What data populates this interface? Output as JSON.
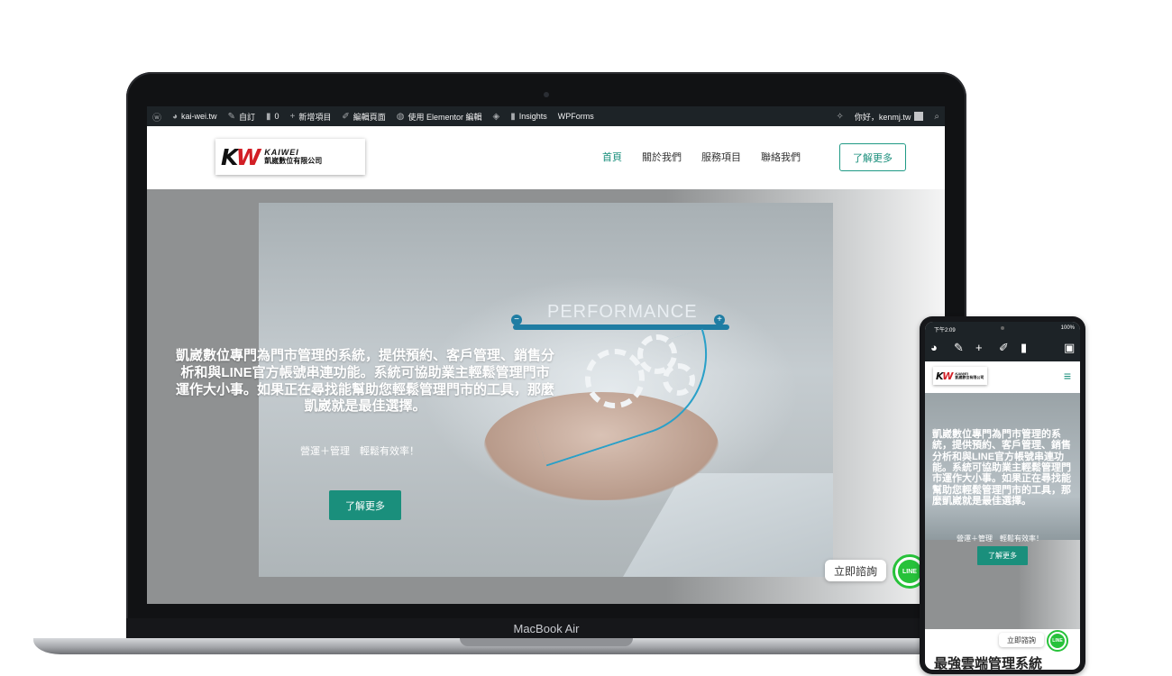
{
  "laptop": {
    "model_label": "MacBook Air",
    "admin_bar": {
      "wp_icon": "wordpress-icon",
      "site": "kai-wei.tw",
      "customize": "自訂",
      "comments_count": "0",
      "new_item": "新增項目",
      "edit_page": "編輯頁面",
      "elementor_edit": "使用 Elementor 編輯",
      "insights": "Insights",
      "wpforms": "WPForms",
      "greeting": "你好，kenmj.tw"
    },
    "header": {
      "logo_en": "KAIWEI",
      "logo_zh": "凱崴數位有限公司",
      "logo_mark_k": "K",
      "logo_mark_w": "W",
      "nav": [
        "首頁",
        "關於我們",
        "服務項目",
        "聯絡我們"
      ],
      "cta": "了解更多"
    },
    "hero": {
      "photo_text": "PERFORMANCE",
      "headline": "凱崴數位專門為門市管理的系統，提供預約、客戶管理、銷售分析和與LINE官方帳號串連功能。系統可協助業主輕鬆管理門市運作大小事。如果正在尋找能幫助您輕鬆管理門市的工具，那麼凱崴就是最佳選擇。",
      "subline": "營運＋管理　輕鬆有效率！",
      "button": "了解更多"
    },
    "floating": {
      "consult_label": "立即諮詢",
      "line_label": "LINE"
    }
  },
  "phone": {
    "status": {
      "time": "下午2:09",
      "battery": "100%"
    },
    "header": {
      "logo_en": "KAIWEI",
      "logo_zh": "凱崴數位有限公司"
    },
    "hero": {
      "headline": "凱崴數位專門為門市管理的系統，提供預約、客戶管理、銷售分析和與LINE官方帳號串連功能。系統可協助業主輕鬆管理門市運作大小事。如果正在尋找能幫助您輕鬆管理門市的工具，那麼凱崴就是最佳選擇。",
      "subline": "營運＋管理　輕鬆有效率！",
      "button": "了解更多"
    },
    "floating": {
      "consult_label": "立即諮詢",
      "line_label": "LINE"
    },
    "bottom_title": "最強雲端管理系統"
  },
  "colors": {
    "brand_green": "#1a8f7c",
    "line_green": "#27c23a",
    "admin_bar": "#1d2327",
    "logo_red": "#d21f26"
  }
}
